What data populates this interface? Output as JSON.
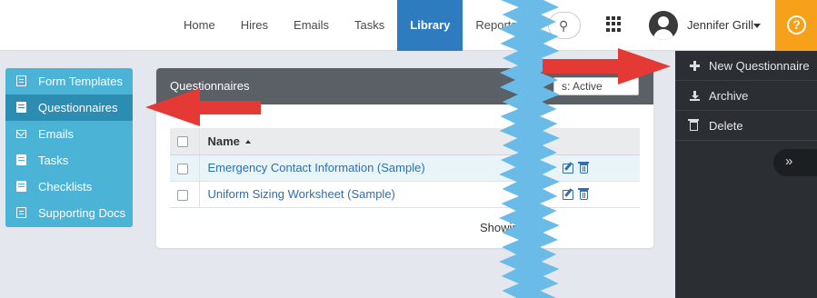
{
  "nav": {
    "items": [
      "Home",
      "Hires",
      "Emails",
      "Tasks",
      "Library",
      "Reports"
    ],
    "active": "Library"
  },
  "user": {
    "name": "Jennifer Grill"
  },
  "help": {
    "label": "?"
  },
  "sidebar": {
    "items": [
      {
        "label": "Form Templates",
        "icon": "document-icon"
      },
      {
        "label": "Questionnaires",
        "icon": "list-icon",
        "active": true
      },
      {
        "label": "Emails",
        "icon": "envelope-icon"
      },
      {
        "label": "Tasks",
        "icon": "list-icon"
      },
      {
        "label": "Checklists",
        "icon": "list-icon"
      },
      {
        "label": "Supporting Docs",
        "icon": "document-icon"
      }
    ]
  },
  "panel": {
    "title": "Questionnaires",
    "status_filter": "s: Active",
    "columns": {
      "name": "Name"
    },
    "rows": [
      {
        "name": "Emergency Contact Information (Sample)"
      },
      {
        "name": "Uniform Sizing Worksheet (Sample)"
      }
    ],
    "footer": "Showin"
  },
  "actions_panel": {
    "items": [
      "New Questionnaire",
      "Archive",
      "Delete"
    ],
    "collapse_label": "»"
  },
  "colors": {
    "nav_active": "#2f7bbf",
    "sidebar": "#4ab3d6",
    "sidebar_active": "#2c8db3",
    "help": "#f7a11a",
    "dark_panel": "#2b2f33",
    "arrow": "#e53935",
    "tear": "#6bbbe8"
  }
}
